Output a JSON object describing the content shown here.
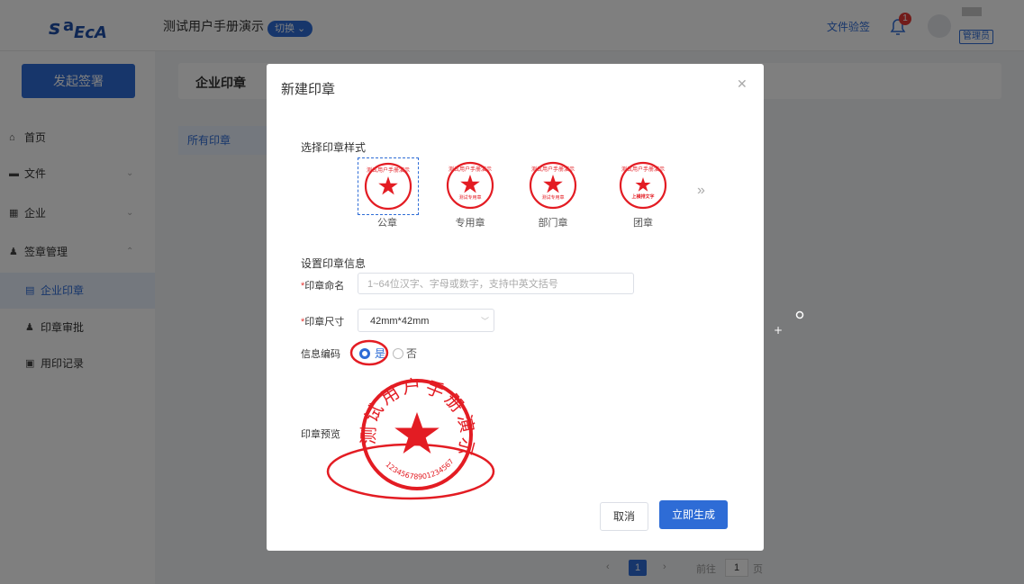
{
  "header": {
    "app_title": "测试用户手册演示",
    "switch_label": "切换",
    "verify_link": "文件验签",
    "notification_count": "1",
    "role_tag": "管理员"
  },
  "sidebar": {
    "primary_button": "发起签署",
    "items": [
      {
        "label": "首页",
        "icon": "home-icon"
      },
      {
        "label": "文件",
        "icon": "folder-icon"
      },
      {
        "label": "企业",
        "icon": "building-icon"
      },
      {
        "label": "签章管理",
        "icon": "user-icon"
      },
      {
        "label": "企业印章",
        "icon": "list-icon"
      },
      {
        "label": "印章审批",
        "icon": "user-check-icon"
      },
      {
        "label": "用印记录",
        "icon": "record-icon"
      }
    ]
  },
  "content": {
    "title": "企业印章",
    "tab_all": "所有印章",
    "pager": {
      "current": "1",
      "goto_label": "前往",
      "goto_value": "1",
      "page_label": "页"
    }
  },
  "modal": {
    "title": "新建印章",
    "style_section": "选择印章样式",
    "styles": [
      {
        "caption": "公章",
        "seal_text": "测试用户手册演示",
        "sub_text": ""
      },
      {
        "caption": "专用章",
        "seal_text": "测试用户手册演示",
        "sub_text": "测试专用章"
      },
      {
        "caption": "部门章",
        "seal_text": "测试用户手册演示",
        "sub_text": "测试专用章"
      },
      {
        "caption": "团章",
        "seal_text": "测试用户手册演示",
        "sub_text": "上横排文字"
      }
    ],
    "info_section": "设置印章信息",
    "name_label": "印章命名",
    "name_placeholder": "1~64位汉字、字母或数字，支持中英文括号",
    "size_label": "印章尺寸",
    "size_value": "42mm*42mm",
    "encode_label": "信息编码",
    "radio_yes": "是",
    "radio_no": "否",
    "preview_label": "印章预览",
    "preview_seal_text": "测试用户手册演示",
    "preview_code": "12345678901234567",
    "cancel": "取消",
    "generate": "立即生成"
  },
  "colors": {
    "accent": "#2e6cd6",
    "seal_red": "#e31c23",
    "badge_red": "#e53935"
  }
}
